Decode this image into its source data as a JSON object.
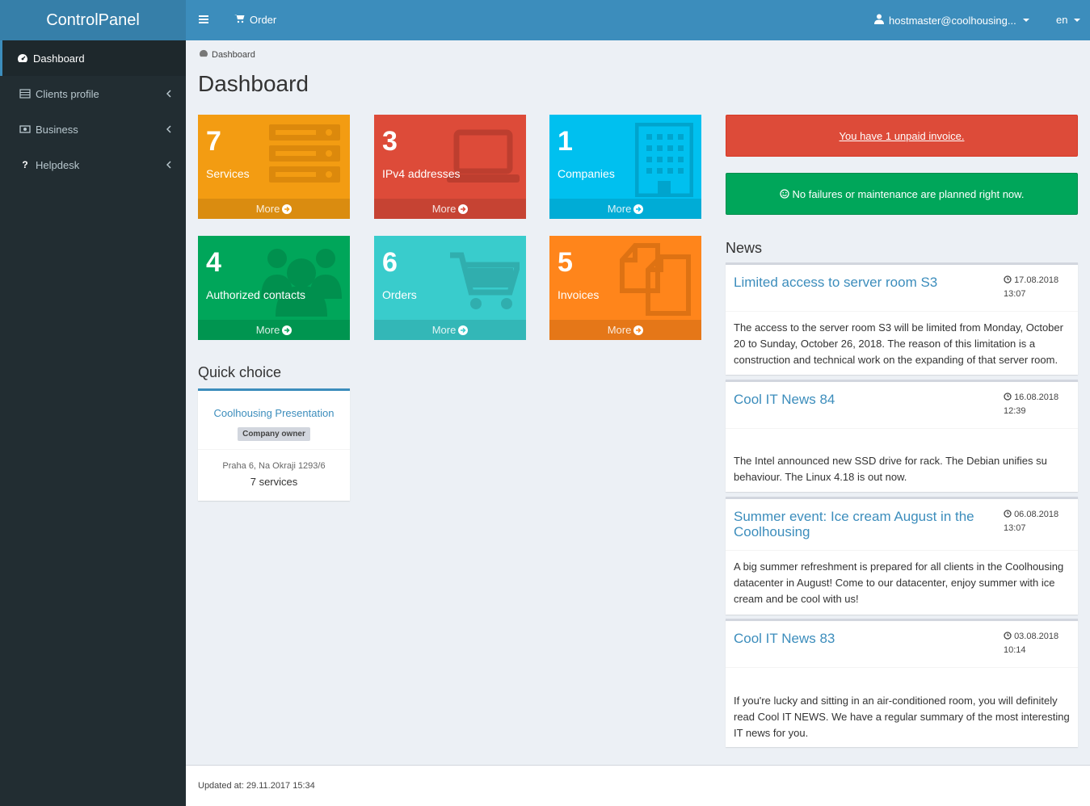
{
  "app": {
    "title": "ControlPanel"
  },
  "sidebar": {
    "items": [
      {
        "label": "Dashboard",
        "icon": "dashboard-icon"
      },
      {
        "label": "Clients profile",
        "icon": "list-icon"
      },
      {
        "label": "Business",
        "icon": "money-icon"
      },
      {
        "label": "Helpdesk",
        "icon": "question-icon"
      }
    ]
  },
  "header": {
    "order_label": "Order",
    "user_label": "hostmaster@coolhousing...",
    "lang_label": "en"
  },
  "breadcrumb": {
    "label": "Dashboard"
  },
  "page": {
    "title": "Dashboard"
  },
  "tiles": [
    {
      "count": "7",
      "label": "Services",
      "more": "More",
      "color": "#f39c12",
      "icon": "server-icon"
    },
    {
      "count": "3",
      "label": "IPv4 addresses",
      "more": "More",
      "color": "#dd4b39",
      "icon": "laptop-icon"
    },
    {
      "count": "1",
      "label": "Companies",
      "more": "More",
      "color": "#00c0ef",
      "icon": "building-icon"
    },
    {
      "count": "4",
      "label": "Authorized contacts",
      "more": "More",
      "color": "#00a65a",
      "icon": "users-icon"
    },
    {
      "count": "6",
      "label": "Orders",
      "more": "More",
      "color": "#39cccc",
      "icon": "cart-icon"
    },
    {
      "count": "5",
      "label": "Invoices",
      "more": "More",
      "color": "#ff851b",
      "icon": "files-icon"
    }
  ],
  "quick_choice": {
    "heading": "Quick choice",
    "company": "Coolhousing Presentation",
    "badge": "Company owner",
    "address": "Praha 6, Na Okraji 1293/6",
    "services": "7 services"
  },
  "alerts": {
    "unpaid": "You have 1 unpaid invoice.",
    "status": "No failures or maintenance are planned right now."
  },
  "news": {
    "heading": "News",
    "items": [
      {
        "title": "Limited access to server room S3",
        "date": "17.08.2018",
        "time": "13:07",
        "body": "The access to the server room S3 will be limited from Monday, October 20 to Sunday, October 26, 2018. The reason of this limitation is a construction and technical work on the expanding of that server room."
      },
      {
        "title": "Cool IT News 84",
        "date": "16.08.2018",
        "time": "12:39",
        "body": "The Intel announced new SSD drive for rack. The Debian unifies su behaviour. The Linux 4.18 is out now."
      },
      {
        "title": "Summer event: Ice cream August in the Coolhousing",
        "date": "06.08.2018",
        "time": "13:07",
        "body": "A big summer refreshment is prepared for all clients in the Coolhousing datacenter in August! Come to our datacenter, enjoy summer with ice cream and be cool with us!"
      },
      {
        "title": "Cool IT News 83",
        "date": "03.08.2018",
        "time": "10:14",
        "body": "If you're lucky and sitting in an air-conditioned room, you will definitely read Cool IT NEWS. We have a regular summary of the most interesting IT news for you."
      }
    ]
  },
  "footer": {
    "updated": "Updated at: 29.11.2017 15:34"
  }
}
